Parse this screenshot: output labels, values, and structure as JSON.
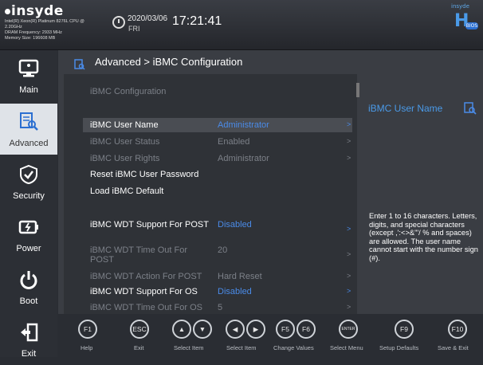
{
  "header": {
    "brand": "insyde",
    "sysinfo": [
      "Intel(R) Xeon(R) Platinum 8276L CPU @",
      "2.20GHz",
      "DRAM Frequency: 2933 MHz",
      "Memory Size: 196608 MB"
    ],
    "date": "2020/03/06",
    "day": "FRI",
    "time": "17:21:41",
    "hbios_top": "insyde",
    "hbios_h": "H",
    "hbios_badge": "BIOS"
  },
  "nav": {
    "items": [
      {
        "label": "Main",
        "icon": "monitor-icon"
      },
      {
        "label": "Advanced",
        "icon": "advanced-icon"
      },
      {
        "label": "Security",
        "icon": "shield-icon"
      },
      {
        "label": "Power",
        "icon": "battery-icon"
      },
      {
        "label": "Boot",
        "icon": "power-icon"
      },
      {
        "label": "Exit",
        "icon": "exit-icon"
      }
    ],
    "active": "Advanced"
  },
  "breadcrumb": "Advanced > iBMC Configuration",
  "section_title": "iBMC Configuration",
  "rows": [
    {
      "name": "iBMC User Name",
      "value": "Administrator",
      "arrow": ">"
    },
    {
      "name": "iBMC User Status",
      "value": "Enabled",
      "arrow": ">"
    },
    {
      "name": "iBMC User Rights",
      "value": "Administrator",
      "arrow": ">"
    },
    {
      "name": "Reset iBMC User Password",
      "value": "",
      "arrow": ""
    },
    {
      "name": "Load iBMC Default",
      "value": "",
      "arrow": ""
    },
    {
      "name": "iBMC WDT Support For POST",
      "value": "Disabled",
      "arrow": ">"
    },
    {
      "name": "iBMC WDT Time Out For POST",
      "value": "20",
      "arrow": ">"
    },
    {
      "name": "iBMC WDT Action For POST",
      "value": "Hard Reset",
      "arrow": ">"
    },
    {
      "name": "iBMC WDT Support For OS",
      "value": "Disabled",
      "arrow": ">"
    },
    {
      "name": "iBMC WDT Time Out For OS",
      "value": "5",
      "arrow": ">"
    }
  ],
  "help": {
    "title": "iBMC User Name",
    "text": "Enter 1 to 16 characters. Letters, digits, and special characters (except ,':<>&\"'/ % and spaces) are allowed. The user name cannot start with the number sign (#)."
  },
  "keys": [
    {
      "key": "F1",
      "label": "Help"
    },
    {
      "key": "ESC",
      "label": "Exit"
    },
    {
      "key": "↑↓",
      "label": "Select Item"
    },
    {
      "key": "←→",
      "label": "Select Item"
    },
    {
      "key": "F5 F6",
      "label": "Change Values"
    },
    {
      "key": "ENTER",
      "label": "Select Menu"
    },
    {
      "key": "F9",
      "label": "Setup Defaults"
    },
    {
      "key": "F10",
      "label": "Save & Exit"
    }
  ],
  "colors": {
    "accent": "#4a8be8",
    "active_nav": "#dfe3e8",
    "background": "#2a2d33"
  }
}
